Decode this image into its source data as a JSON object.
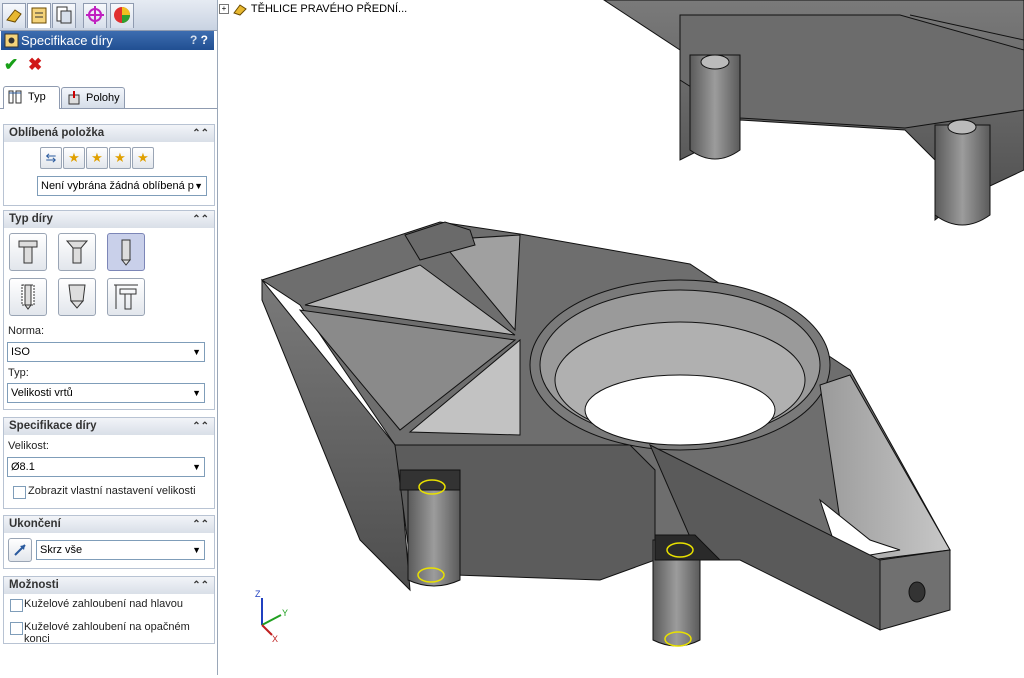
{
  "icon_tabs": [
    "feature-manager-icon",
    "property-manager-icon",
    "configuration-manager-icon",
    "dimxpert-icon",
    "display-manager-icon"
  ],
  "property_manager": {
    "title": "Specifikace díry",
    "help": "?"
  },
  "tabs": [
    {
      "label": "Typ",
      "active": true
    },
    {
      "label": "Polohy",
      "active": false
    }
  ],
  "favorites": {
    "header": "Oblíbená položka",
    "select_value": "Není vybrána žádná oblíbená p"
  },
  "hole_type": {
    "header": "Typ díry",
    "norm_label": "Norma:",
    "norm_value": "ISO",
    "type_label": "Typ:",
    "type_value": "Velikosti vrtů"
  },
  "hole_spec": {
    "header": "Specifikace díry",
    "size_label": "Velikost:",
    "size_value": "Ø8.1",
    "custom_size_label": "Zobrazit vlastní nastavení velikosti"
  },
  "end_condition": {
    "header": "Ukončení",
    "value": "Skrz vše"
  },
  "options": {
    "header": "Možnosti",
    "option1": "Kuželové zahloubení nad hlavou",
    "option2": "Kuželové zahloubení na opačném konci"
  },
  "feature_tree": {
    "item": "TĚHLICE PRAVÉHO PŘEDNÍ..."
  },
  "triad": {
    "x": "X",
    "y": "Y",
    "z": "Z"
  },
  "colors": {
    "accent": "#2a5a9e",
    "model": "#6b6b6b",
    "hole_highlight": "#e8e000"
  }
}
